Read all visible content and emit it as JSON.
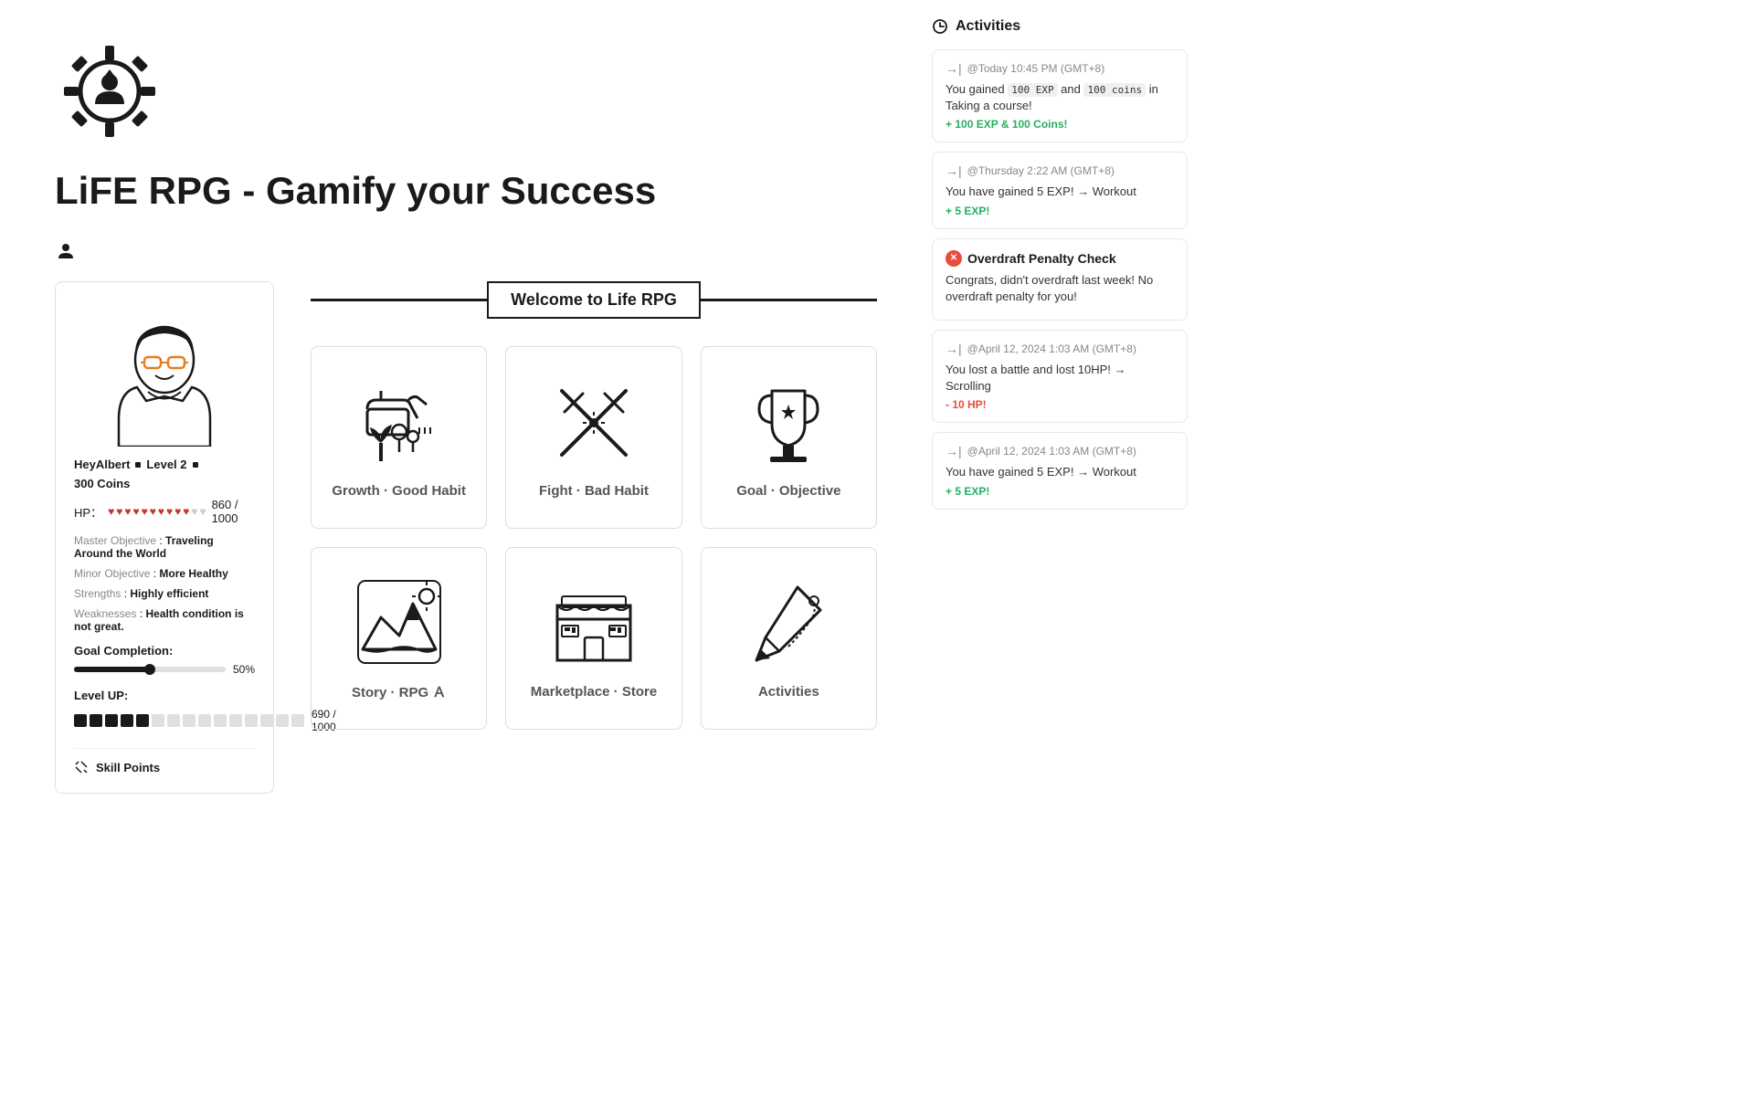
{
  "page": {
    "title": "LiFE RPG - Gamify your Success"
  },
  "character": {
    "name": "HeyAlbert",
    "level": "Level 2",
    "coins": "300 Coins",
    "hp_current": 860,
    "hp_max": 1000,
    "hp_filled": 10,
    "hp_empty": 2,
    "master_objective_label": "Master Objective",
    "master_objective_value": "Traveling Around the World",
    "minor_objective_label": "Minor Objective",
    "minor_objective_value": "More Healthy",
    "strengths_label": "Strengths",
    "strengths_value": "Highly efficient",
    "weaknesses_label": "Weaknesses",
    "weaknesses_value": "Health condition is not great.",
    "goal_completion_label": "Goal Completion:",
    "goal_completion_percent": "50%",
    "level_up_label": "Level UP:",
    "level_up_current": 690,
    "level_up_max": 1000,
    "level_up_filled": 5,
    "level_up_empty": 10,
    "skill_points_label": "Skill Points"
  },
  "welcome": {
    "text": "Welcome to Life RPG"
  },
  "cards": [
    {
      "id": "growth-good-habit",
      "label": "Growth · Good Habit",
      "icon": "plant"
    },
    {
      "id": "fight-bad-habit",
      "label": "Fight · Bad Habit",
      "icon": "swords"
    },
    {
      "id": "goal-objective",
      "label": "Goal · Objective",
      "icon": "trophy"
    },
    {
      "id": "story-rpg",
      "label": "Story · RPG",
      "icon": "mountain"
    },
    {
      "id": "marketplace",
      "label": "Marketplace · Store",
      "icon": "store"
    },
    {
      "id": "activities",
      "label": "Activities",
      "icon": "pen"
    }
  ],
  "activities": {
    "header": "Activities",
    "items": [
      {
        "timestamp": "@Today 10:45 PM (GMT+8)",
        "description_before": "You gained",
        "exp_badge": "100 EXP",
        "connector": "and",
        "coins_badge": "100 coins",
        "description_after": "in Taking a course!",
        "reward": "+ 100 EXP & 100 Coins!",
        "type": "reward"
      },
      {
        "timestamp": "@Thursday 2:22 AM (GMT+8)",
        "description": "You have gained 5 EXP! → Workout",
        "reward": "+ 5 EXP!",
        "type": "reward"
      },
      {
        "overdraft": true,
        "header": "Overdraft Penalty Check",
        "description": "Congrats, didn't overdraft last week! No overdraft penalty for you!"
      },
      {
        "timestamp": "@April 12, 2024 1:03 AM (GMT+8)",
        "description": "You lost a battle and lost 10HP! → Scrolling",
        "reward": "- 10 HP!",
        "type": "penalty"
      },
      {
        "timestamp": "@April 12, 2024 1:03 AM (GMT+8)",
        "description": "You have gained 5 EXP! → Workout",
        "reward": "+ 5 EXP!",
        "type": "reward"
      }
    ]
  }
}
